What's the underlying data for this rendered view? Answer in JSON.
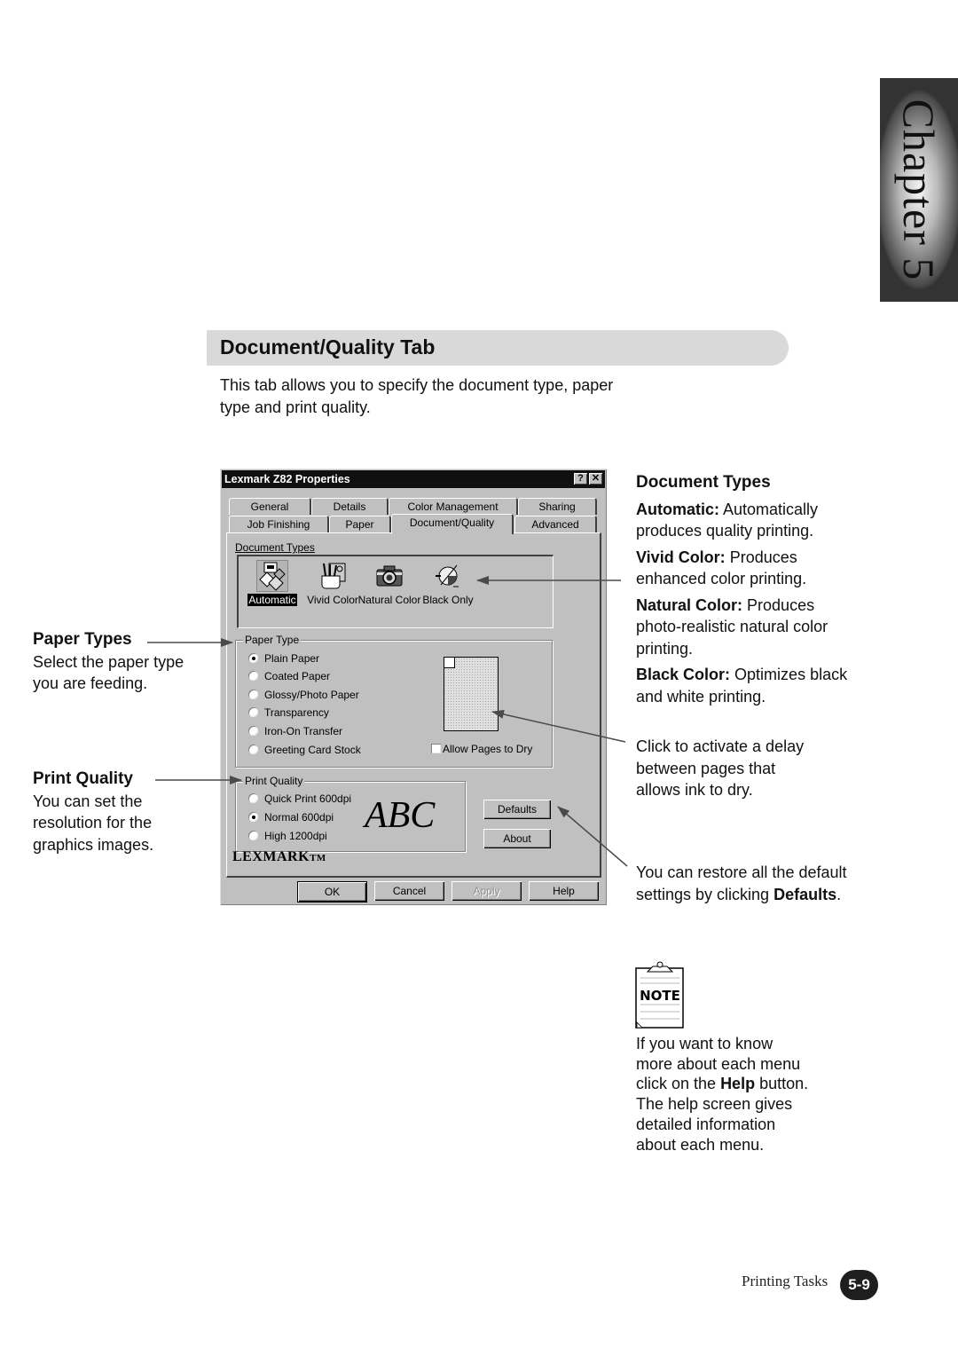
{
  "chapter_tab": "Chapter 5",
  "section": {
    "title": "Document/Quality Tab",
    "intro": "This tab allows you to specify the document type, paper type and print quality."
  },
  "dialog": {
    "title": "Lexmark Z82 Properties",
    "help_button": "?",
    "close_button": "✕",
    "tabs_row1": [
      "General",
      "Details",
      "Color Management",
      "Sharing"
    ],
    "tabs_row2": [
      "Job Finishing",
      "Paper",
      "Document/Quality",
      "Advanced"
    ],
    "active_tab": "Document/Quality",
    "document_types": {
      "label": "Document Types",
      "items": [
        {
          "label": "Automatic",
          "icon": "automatic-doc-icon",
          "selected": true
        },
        {
          "label": "Vivid Color",
          "icon": "vivid-color-icon",
          "selected": false
        },
        {
          "label": "Natural Color",
          "icon": "camera-icon",
          "selected": false
        },
        {
          "label": "Black Only",
          "icon": "black-only-icon",
          "selected": false
        }
      ]
    },
    "paper_type": {
      "label": "Paper Type",
      "options": [
        {
          "label": "Plain Paper",
          "selected": true
        },
        {
          "label": "Coated Paper",
          "selected": false
        },
        {
          "label": "Glossy/Photo Paper",
          "selected": false
        },
        {
          "label": "Transparency",
          "selected": false
        },
        {
          "label": "Iron-On Transfer",
          "selected": false
        },
        {
          "label": "Greeting Card Stock",
          "selected": false
        }
      ],
      "allow_pages_to_dry": {
        "label": "Allow Pages to Dry",
        "checked": false
      }
    },
    "print_quality": {
      "label": "Print Quality",
      "options": [
        {
          "label": "Quick Print 600dpi",
          "selected": false
        },
        {
          "label": "Normal 600dpi",
          "selected": true
        },
        {
          "label": "High 1200dpi",
          "selected": false
        }
      ],
      "preview_text": "ABC"
    },
    "side_buttons": {
      "defaults": "Defaults",
      "about": "About"
    },
    "logo": "LEXMARK",
    "logo_suffix": "TM",
    "footer_buttons": {
      "ok": "OK",
      "cancel": "Cancel",
      "apply": "Apply",
      "help": "Help"
    }
  },
  "callouts": {
    "paper_types": {
      "title": "Paper Types",
      "body": "Select the paper type you are feeding."
    },
    "print_quality": {
      "title": "Print Quality",
      "body": "You can set the resolution for the graphics images."
    },
    "document_types": {
      "title": "Document Types",
      "items": [
        {
          "term": "Automatic:",
          "desc": "Automatically produces quality printing."
        },
        {
          "term": "Vivid Color:",
          "desc": "Produces enhanced color printing."
        },
        {
          "term": "Natural Color:",
          "desc": "Produces photo-realistic natural color printing."
        },
        {
          "term": "Black Color:",
          "desc": "Optimizes black and white printing."
        }
      ]
    },
    "allow_dry": "Click to activate a delay between pages that allows ink to dry.",
    "defaults_pre": "You can restore all the default settings by clicking",
    "defaults_bold": "Defaults",
    "defaults_post": "."
  },
  "note": {
    "icon_label": "NOTE",
    "pre": "If you want to know more about each menu click on the",
    "bold": "Help",
    "post": "button. The help screen gives detailed information about each menu."
  },
  "footer": {
    "section": "Printing Tasks",
    "page": "5-9"
  }
}
